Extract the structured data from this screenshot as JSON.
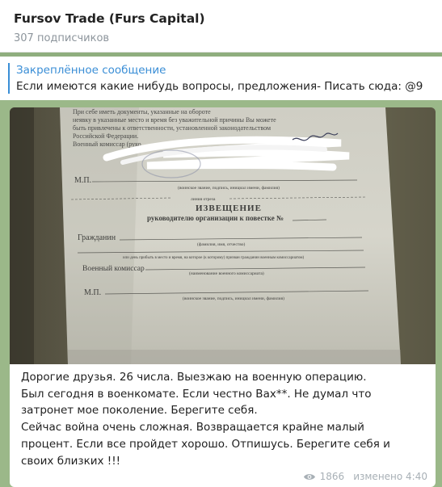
{
  "header": {
    "title": "Fursov Trade (Furs Capital)",
    "subscribers": "307 подписчиков"
  },
  "pinned": {
    "label": "Закреплённое сообщение",
    "text": "Если имеются какие нибудь вопросы, предложения- Писать сюда: @9"
  },
  "post": {
    "photo_text": {
      "top_lines": [
        "При себе иметь документы, указанные на обороте",
        "неявку в указанные место и время без уважительной причины Вы можете",
        "быть привлечены к ответственности, установленной законодательством",
        "Российской Федерации.",
        "Военный комиссар (руко"
      ],
      "mp1": "М.П.",
      "mp1_caption": "(воинское звание, подпись, инициал имени, фамилия)",
      "linia_otreza": "линия отреза",
      "heading": "ИЗВЕЩЕНИЕ",
      "subheading": "руководителю организации к повестке №",
      "grazhdanin": "Гражданин",
      "fio_caption": "(фамилия, имя, отчество)",
      "vyzyvaetsya_caption": "или день прибыть в место и время, на которое (к которому) призван гражданин военным комиссариатом)",
      "komissar": "Военный комиссар",
      "komissariat_caption": "(наименование военного комиссариата)",
      "mp2": "М.П.",
      "mp2_caption": "(воинское звание, подпись, инициал имени, фамилия)"
    },
    "caption_lines": [
      "Дорогие друзья. 26 числа. Выезжаю на военную операцию.",
      "Был сегодня в военкомате. Если честно Вах**. Не думал что",
      "затронет мое поколение. Берегите себя.",
      "Сейчас война очень сложная. Возвращается крайне малый",
      "процент.  Если все пройдет хорошо. Отпишусь. Берегите себя и",
      "своих близких !!!"
    ],
    "views": "1866",
    "edited": "изменено 4:40"
  },
  "colors": {
    "accent": "#3a8ed6",
    "background": "#8fae7e",
    "meta": "#a8b0b6"
  },
  "icons": [
    "eye-icon"
  ]
}
